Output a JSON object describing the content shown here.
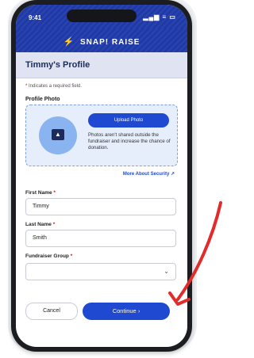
{
  "status": {
    "time": "9:41",
    "icons": "▂▄▆ ≡ ▭"
  },
  "brand": {
    "name": "SNAP! RAISE"
  },
  "header": {
    "title": "Timmy's Profile"
  },
  "form": {
    "required_note": "Indicates a required field.",
    "required_star": "*",
    "photo_label": "Profile Photo",
    "upload_label": "Upload Photo",
    "photo_note": "Photos aren't shared outside the fundraiser and increase the chance of donation.",
    "security_link": "More About Security",
    "first_name_label": "First Name",
    "first_name_value": "Timmy",
    "last_name_label": "Last Name",
    "last_name_value": "Smith",
    "group_label": "Fundraiser Group",
    "group_value": "",
    "cancel_label": "Cancel",
    "continue_label": "Continue",
    "continue_chevron": "›"
  },
  "colors": {
    "brand_blue": "#1f3aa8",
    "button_blue": "#1f49d0",
    "arrow_red": "#e32b2b"
  }
}
